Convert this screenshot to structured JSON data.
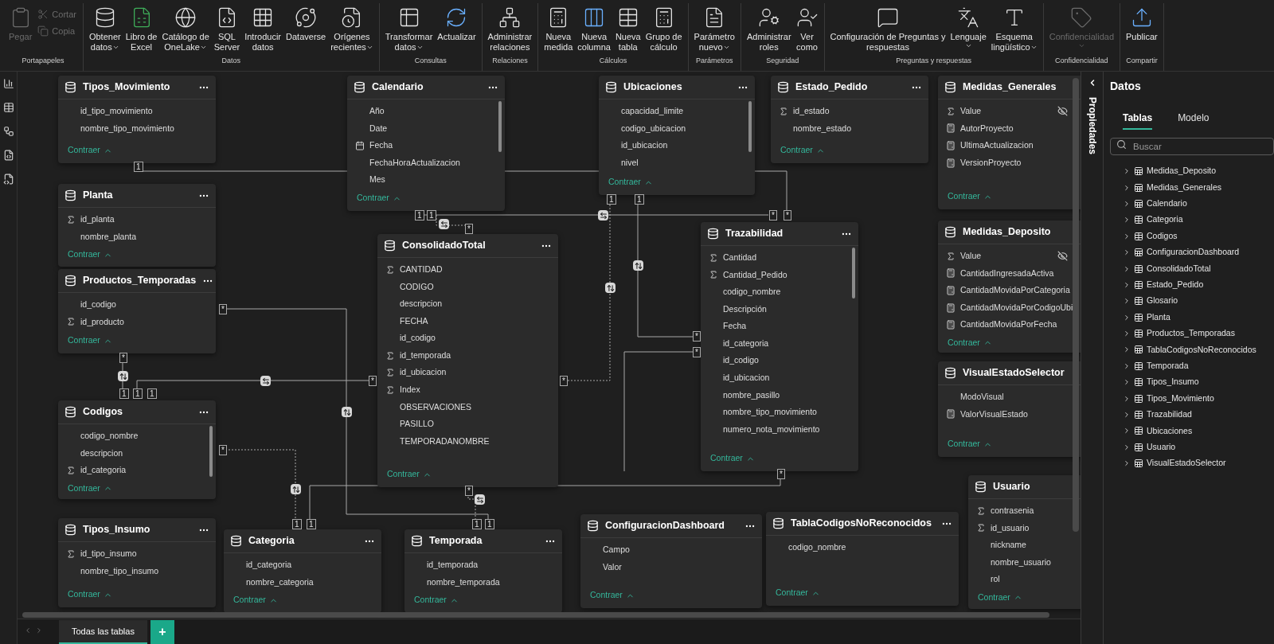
{
  "ribbon": {
    "groups": [
      {
        "label": "Portapapeles",
        "buttons": [
          {
            "lines": [
              "Pegar"
            ],
            "dropdown": false,
            "disabled": true,
            "kind": "large"
          },
          {
            "lines": [
              "Cortar"
            ],
            "dropdown": false,
            "disabled": true,
            "kind": "small"
          },
          {
            "lines": [
              "Copia"
            ],
            "dropdown": false,
            "disabled": true,
            "kind": "small"
          }
        ]
      },
      {
        "label": "Datos",
        "buttons": [
          {
            "lines": [
              "Obtener",
              "datos"
            ],
            "dropdown": true,
            "disabled": false,
            "kind": "large"
          },
          {
            "lines": [
              "Libro de",
              "Excel"
            ],
            "dropdown": false,
            "disabled": false,
            "kind": "large"
          },
          {
            "lines": [
              "Catálogo de",
              "OneLake"
            ],
            "dropdown": true,
            "disabled": false,
            "kind": "large"
          },
          {
            "lines": [
              "SQL",
              "Server"
            ],
            "dropdown": false,
            "disabled": false,
            "kind": "large"
          },
          {
            "lines": [
              "Introducir",
              "datos"
            ],
            "dropdown": false,
            "disabled": false,
            "kind": "large"
          },
          {
            "lines": [
              "Dataverse"
            ],
            "dropdown": false,
            "disabled": false,
            "kind": "large"
          },
          {
            "lines": [
              "Orígenes",
              "recientes"
            ],
            "dropdown": true,
            "disabled": false,
            "kind": "large"
          }
        ]
      },
      {
        "label": "Consultas",
        "buttons": [
          {
            "lines": [
              "Transformar",
              "datos"
            ],
            "dropdown": true,
            "disabled": false,
            "kind": "large"
          },
          {
            "lines": [
              "Actualizar"
            ],
            "dropdown": false,
            "disabled": false,
            "kind": "large"
          }
        ]
      },
      {
        "label": "Relaciones",
        "buttons": [
          {
            "lines": [
              "Administrar",
              "relaciones"
            ],
            "dropdown": false,
            "disabled": false,
            "kind": "large"
          }
        ]
      },
      {
        "label": "Cálculos",
        "buttons": [
          {
            "lines": [
              "Nueva",
              "medida"
            ],
            "dropdown": false,
            "disabled": false,
            "kind": "large"
          },
          {
            "lines": [
              "Nueva",
              "columna"
            ],
            "dropdown": false,
            "disabled": false,
            "kind": "large"
          },
          {
            "lines": [
              "Nueva",
              "tabla"
            ],
            "dropdown": false,
            "disabled": false,
            "kind": "large"
          },
          {
            "lines": [
              "Grupo de",
              "cálculo"
            ],
            "dropdown": false,
            "disabled": false,
            "kind": "large"
          }
        ]
      },
      {
        "label": "Parámetros",
        "buttons": [
          {
            "lines": [
              "Parámetro",
              "nuevo"
            ],
            "dropdown": true,
            "disabled": false,
            "kind": "large"
          }
        ]
      },
      {
        "label": "Seguridad",
        "buttons": [
          {
            "lines": [
              "Administrar",
              "roles"
            ],
            "dropdown": false,
            "disabled": false,
            "kind": "large"
          },
          {
            "lines": [
              "Ver",
              "como"
            ],
            "dropdown": false,
            "disabled": false,
            "kind": "large"
          }
        ]
      },
      {
        "label": "Preguntas y respuestas",
        "buttons": [
          {
            "lines": [
              "Configuración de Preguntas y",
              "respuestas"
            ],
            "dropdown": false,
            "disabled": false,
            "kind": "large"
          },
          {
            "lines": [
              "Lenguaje"
            ],
            "dropdown": true,
            "disabled": false,
            "kind": "large"
          },
          {
            "lines": [
              "Esquema",
              "lingüístico"
            ],
            "dropdown": true,
            "disabled": false,
            "kind": "large"
          }
        ]
      },
      {
        "label": "Confidencialidad",
        "buttons": [
          {
            "lines": [
              "Confidencialidad"
            ],
            "dropdown": true,
            "disabled": true,
            "kind": "large"
          }
        ]
      },
      {
        "label": "Compartir",
        "buttons": [
          {
            "lines": [
              "Publicar"
            ],
            "dropdown": false,
            "disabled": false,
            "kind": "large"
          }
        ]
      }
    ]
  },
  "tables": [
    {
      "name": "Tipos_Movimiento",
      "collapse": "Contraer",
      "fields": [
        {
          "name": "id_tipo_movimiento",
          "kind": "plain",
          "hidden": false
        },
        {
          "name": "nombre_tipo_movimiento",
          "kind": "plain",
          "hidden": false
        }
      ]
    },
    {
      "name": "Calendario",
      "collapse": "Contraer",
      "fields": [
        {
          "name": "Año",
          "kind": "plain",
          "hidden": false
        },
        {
          "name": "Date",
          "kind": "plain",
          "hidden": false
        },
        {
          "name": "Fecha",
          "kind": "hierarchy",
          "hidden": false
        },
        {
          "name": "FechaHoraActualizacion",
          "kind": "plain",
          "hidden": false
        },
        {
          "name": "Mes",
          "kind": "plain",
          "hidden": false
        }
      ]
    },
    {
      "name": "Ubicaciones",
      "collapse": "Contraer",
      "fields": [
        {
          "name": "capacidad_limite",
          "kind": "plain",
          "hidden": false
        },
        {
          "name": "codigo_ubicacion",
          "kind": "plain",
          "hidden": false
        },
        {
          "name": "id_ubicacion",
          "kind": "plain",
          "hidden": false
        },
        {
          "name": "nivel",
          "kind": "plain",
          "hidden": false
        }
      ]
    },
    {
      "name": "Estado_Pedido",
      "collapse": "Contraer",
      "fields": [
        {
          "name": "id_estado",
          "kind": "sum",
          "hidden": false
        },
        {
          "name": "nombre_estado",
          "kind": "plain",
          "hidden": false
        }
      ]
    },
    {
      "name": "Medidas_Generales",
      "collapse": "Contraer",
      "fields": [
        {
          "name": "Value",
          "kind": "sum",
          "hidden": true
        },
        {
          "name": "AutorProyecto",
          "kind": "measure",
          "hidden": false
        },
        {
          "name": "UltimaActualizacion",
          "kind": "measure",
          "hidden": false
        },
        {
          "name": "VersionProyecto",
          "kind": "measure",
          "hidden": false
        }
      ]
    },
    {
      "name": "Planta",
      "collapse": "Contraer",
      "fields": [
        {
          "name": "id_planta",
          "kind": "sum",
          "hidden": false
        },
        {
          "name": "nombre_planta",
          "kind": "plain",
          "hidden": false
        }
      ]
    },
    {
      "name": "Productos_Temporadas",
      "collapse": "Contraer",
      "fields": [
        {
          "name": "id_codigo",
          "kind": "plain",
          "hidden": false
        },
        {
          "name": "id_producto",
          "kind": "sum",
          "hidden": false
        }
      ]
    },
    {
      "name": "ConsolidadoTotal",
      "collapse": "Contraer",
      "fields": [
        {
          "name": "CANTIDAD",
          "kind": "sum",
          "hidden": false
        },
        {
          "name": "CODIGO",
          "kind": "plain",
          "hidden": false
        },
        {
          "name": "descripcion",
          "kind": "plain",
          "hidden": false
        },
        {
          "name": "FECHA",
          "kind": "plain",
          "hidden": false
        },
        {
          "name": "id_codigo",
          "kind": "plain",
          "hidden": false
        },
        {
          "name": "id_temporada",
          "kind": "sum",
          "hidden": false
        },
        {
          "name": "id_ubicacion",
          "kind": "sum",
          "hidden": false
        },
        {
          "name": "Index",
          "kind": "sum",
          "hidden": false
        },
        {
          "name": "OBSERVACIONES",
          "kind": "plain",
          "hidden": false
        },
        {
          "name": "PASILLO",
          "kind": "plain",
          "hidden": false
        },
        {
          "name": "TEMPORADANOMBRE",
          "kind": "plain",
          "hidden": false
        }
      ]
    },
    {
      "name": "Trazabilidad",
      "collapse": "Contraer",
      "fields": [
        {
          "name": "Cantidad",
          "kind": "sum",
          "hidden": false
        },
        {
          "name": "Cantidad_Pedido",
          "kind": "sum",
          "hidden": false
        },
        {
          "name": "codigo_nombre",
          "kind": "plain",
          "hidden": false
        },
        {
          "name": "Descripción",
          "kind": "plain",
          "hidden": false
        },
        {
          "name": "Fecha",
          "kind": "plain",
          "hidden": false
        },
        {
          "name": "id_categoria",
          "kind": "plain",
          "hidden": false
        },
        {
          "name": "id_codigo",
          "kind": "plain",
          "hidden": false
        },
        {
          "name": "id_ubicacion",
          "kind": "plain",
          "hidden": false
        },
        {
          "name": "nombre_pasillo",
          "kind": "plain",
          "hidden": false
        },
        {
          "name": "nombre_tipo_movimiento",
          "kind": "plain",
          "hidden": false
        },
        {
          "name": "numero_nota_movimiento",
          "kind": "plain",
          "hidden": false
        }
      ]
    },
    {
      "name": "Medidas_Deposito",
      "collapse": "Contraer",
      "fields": [
        {
          "name": "Value",
          "kind": "sum",
          "hidden": true
        },
        {
          "name": "CantidadIngresadaActiva",
          "kind": "measure",
          "hidden": false
        },
        {
          "name": "CantidadMovidaPorCategoria",
          "kind": "measure",
          "hidden": false
        },
        {
          "name": "CantidadMovidaPorCodigoUbi",
          "kind": "measure",
          "hidden": false
        },
        {
          "name": "CantidadMovidaPorFecha",
          "kind": "measure",
          "hidden": false
        }
      ]
    },
    {
      "name": "VisualEstadoSelector",
      "collapse": "Contraer",
      "fields": [
        {
          "name": "ModoVisual",
          "kind": "plain",
          "hidden": false
        },
        {
          "name": "ValorVisualEstado",
          "kind": "measure",
          "hidden": false
        }
      ]
    },
    {
      "name": "Codigos",
      "collapse": "Contraer",
      "fields": [
        {
          "name": "codigo_nombre",
          "kind": "plain",
          "hidden": false
        },
        {
          "name": "descripcion",
          "kind": "plain",
          "hidden": false
        },
        {
          "name": "id_categoria",
          "kind": "sum",
          "hidden": false
        }
      ]
    },
    {
      "name": "Tipos_Insumo",
      "collapse": "Contraer",
      "fields": [
        {
          "name": "id_tipo_insumo",
          "kind": "sum",
          "hidden": false
        },
        {
          "name": "nombre_tipo_insumo",
          "kind": "plain",
          "hidden": false
        }
      ]
    },
    {
      "name": "Categoria",
      "collapse": "Contraer",
      "fields": [
        {
          "name": "id_categoria",
          "kind": "plain",
          "hidden": false
        },
        {
          "name": "nombre_categoria",
          "kind": "plain",
          "hidden": false
        }
      ]
    },
    {
      "name": "Temporada",
      "collapse": "Contraer",
      "fields": [
        {
          "name": "id_temporada",
          "kind": "plain",
          "hidden": false
        },
        {
          "name": "nombre_temporada",
          "kind": "plain",
          "hidden": false
        }
      ]
    },
    {
      "name": "ConfiguracionDashboard",
      "collapse": "Contraer",
      "fields": [
        {
          "name": "Campo",
          "kind": "plain",
          "hidden": false
        },
        {
          "name": "Valor",
          "kind": "plain",
          "hidden": false
        }
      ]
    },
    {
      "name": "TablaCodigosNoReconocidos",
      "collapse": "Contraer",
      "fields": [
        {
          "name": "codigo_nombre",
          "kind": "plain",
          "hidden": false
        }
      ]
    },
    {
      "name": "Usuario",
      "collapse": "Contraer",
      "fields": [
        {
          "name": "contrasenia",
          "kind": "sum",
          "hidden": false
        },
        {
          "name": "id_usuario",
          "kind": "sum",
          "hidden": false
        },
        {
          "name": "nickname",
          "kind": "plain",
          "hidden": false
        },
        {
          "name": "nombre_usuario",
          "kind": "plain",
          "hidden": false
        },
        {
          "name": "rol",
          "kind": "plain",
          "hidden": false
        }
      ]
    }
  ],
  "cardinality_markers": [
    "1",
    "1",
    "1",
    "*",
    "1",
    "1",
    "*",
    "*",
    "*",
    "*",
    "1",
    "1",
    "1",
    "*",
    "*",
    "*",
    "*",
    "*",
    "*",
    "*",
    "1",
    "1",
    "1",
    "1"
  ],
  "properties_pane": {
    "title": "Propiedades"
  },
  "data_pane": {
    "title": "Datos",
    "tabs": [
      {
        "label": "Tablas",
        "selected": true
      },
      {
        "label": "Modelo",
        "selected": false
      }
    ],
    "search": {
      "placeholder": "Buscar"
    },
    "items": [
      {
        "name": "Medidas_Deposito",
        "kind": "calculated"
      },
      {
        "name": "Medidas_Generales",
        "kind": "calculated"
      },
      {
        "name": "Calendario",
        "kind": "calculated"
      },
      {
        "name": "Categoria",
        "kind": "table"
      },
      {
        "name": "Codigos",
        "kind": "table"
      },
      {
        "name": "ConfiguracionDashboard",
        "kind": "calculated"
      },
      {
        "name": "ConsolidadoTotal",
        "kind": "table"
      },
      {
        "name": "Estado_Pedido",
        "kind": "table"
      },
      {
        "name": "Glosario",
        "kind": "table"
      },
      {
        "name": "Planta",
        "kind": "table"
      },
      {
        "name": "Productos_Temporadas",
        "kind": "table"
      },
      {
        "name": "TablaCodigosNoReconocidos",
        "kind": "calculated"
      },
      {
        "name": "Temporada",
        "kind": "table"
      },
      {
        "name": "Tipos_Insumo",
        "kind": "table"
      },
      {
        "name": "Tipos_Movimiento",
        "kind": "table"
      },
      {
        "name": "Trazabilidad",
        "kind": "table"
      },
      {
        "name": "Ubicaciones",
        "kind": "table"
      },
      {
        "name": "Usuario",
        "kind": "table"
      },
      {
        "name": "VisualEstadoSelector",
        "kind": "calculated"
      }
    ]
  },
  "layout_tabs": [
    {
      "label": "Todas las tablas",
      "selected": true
    }
  ],
  "add_tab": "+"
}
